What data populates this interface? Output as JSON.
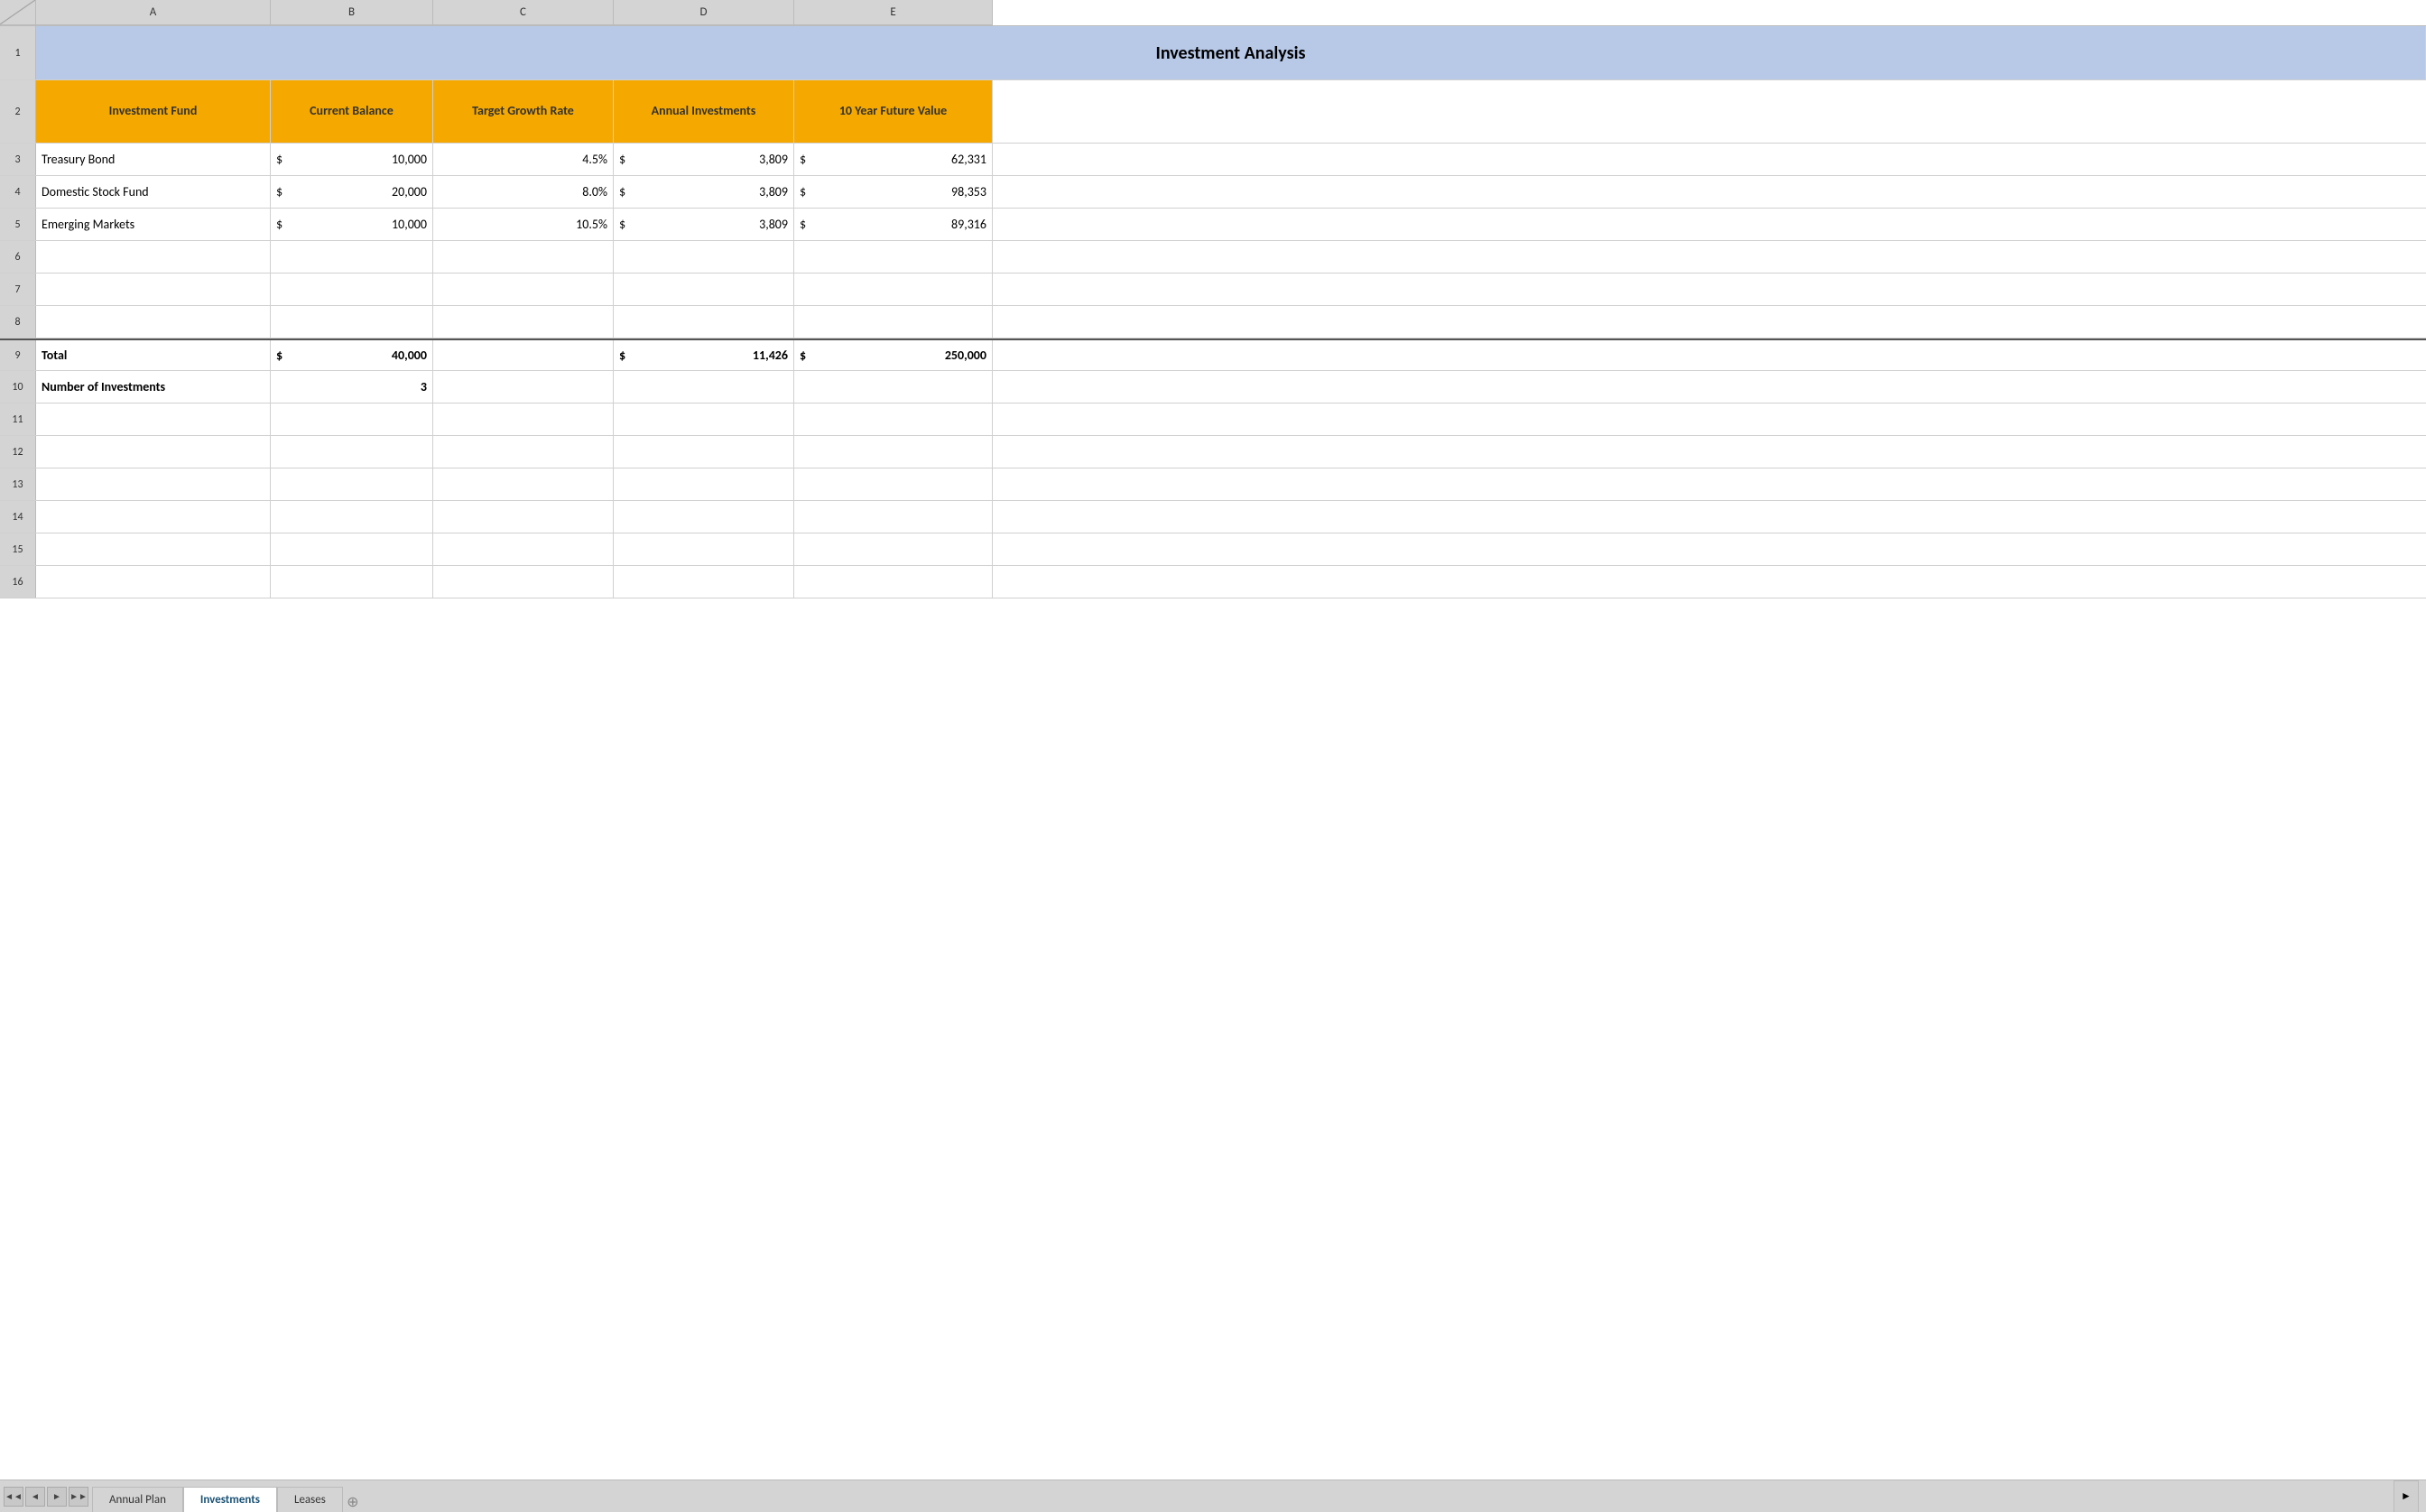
{
  "title": "Investment Analysis",
  "columns": [
    {
      "id": "row_num",
      "label": ""
    },
    {
      "id": "A",
      "label": "A"
    },
    {
      "id": "B",
      "label": "B"
    },
    {
      "id": "C",
      "label": "C"
    },
    {
      "id": "D",
      "label": "D"
    },
    {
      "id": "E",
      "label": "E"
    }
  ],
  "col_widths": {
    "A": 260,
    "B": 180,
    "C": 200,
    "D": 200,
    "E": 220
  },
  "header_row": {
    "col_a": "Investment Fund",
    "col_b": "Current Balance",
    "col_c": "Target Growth Rate",
    "col_d": "Annual Investments",
    "col_e": "10 Year Future Value"
  },
  "data_rows": [
    {
      "row": 3,
      "fund": "Treasury Bond",
      "balance_sym": "$",
      "balance_val": "10,000",
      "growth_rate": "4.5%",
      "annual_sym": "$",
      "annual_val": "3,809",
      "future_sym": "$",
      "future_val": "62,331"
    },
    {
      "row": 4,
      "fund": "Domestic Stock Fund",
      "balance_sym": "$",
      "balance_val": "20,000",
      "growth_rate": "8.0%",
      "annual_sym": "$",
      "annual_val": "3,809",
      "future_sym": "$",
      "future_val": "98,353"
    },
    {
      "row": 5,
      "fund": "Emerging Markets",
      "balance_sym": "$",
      "balance_val": "10,000",
      "growth_rate": "10.5%",
      "annual_sym": "$",
      "annual_val": "3,809",
      "future_sym": "$",
      "future_val": "89,316"
    }
  ],
  "total_row": {
    "label": "Total",
    "balance_sym": "$",
    "balance_val": "40,000",
    "annual_sym": "$",
    "annual_val": "11,426",
    "future_sym": "$",
    "future_val": "250,000"
  },
  "count_row": {
    "label": "Number of Investments",
    "value": "3"
  },
  "empty_rows": [
    6,
    7,
    8,
    11,
    12,
    13,
    14,
    15,
    16
  ],
  "sheet_tabs": [
    {
      "id": "annual-plan",
      "label": "Annual Plan",
      "active": false
    },
    {
      "id": "investments",
      "label": "Investments",
      "active": true
    },
    {
      "id": "leases",
      "label": "Leases",
      "active": false
    }
  ],
  "nav_buttons": {
    "first": "◄◄",
    "prev": "◄",
    "next": "►",
    "last": "►►"
  },
  "scroll": {
    "right_arrow": "►"
  }
}
